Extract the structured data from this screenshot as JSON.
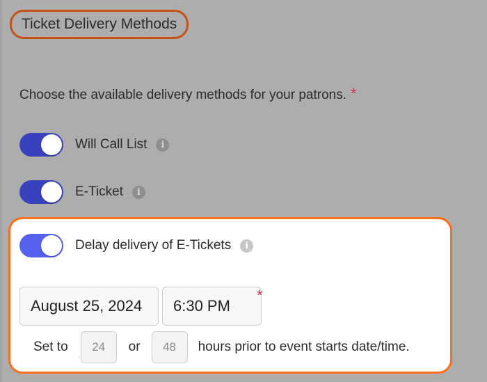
{
  "section": {
    "title": "Ticket Delivery Methods"
  },
  "prompt": {
    "text": "Choose the available delivery methods for your patrons.",
    "required_mark": "*"
  },
  "methods": [
    {
      "label": "Will Call List",
      "enabled": true
    },
    {
      "label": "E-Ticket",
      "enabled": true
    }
  ],
  "delay": {
    "label": "Delay delivery of E-Tickets",
    "enabled": true,
    "date": "August 25, 2024",
    "time": "6:30 PM",
    "required_mark": "*",
    "set_to_label": "Set to",
    "option_a": "24",
    "or_label": "or",
    "option_b": "48",
    "suffix": "hours prior to event starts date/time."
  },
  "info_glyph": "i",
  "colors": {
    "page_bg": "#adadad",
    "toggle_on": "#3a41bd",
    "toggle_on_highlight": "#5661f0",
    "title_outline": "#c4501a",
    "card_outline": "#ff6d1a",
    "required": "#d4305a"
  }
}
